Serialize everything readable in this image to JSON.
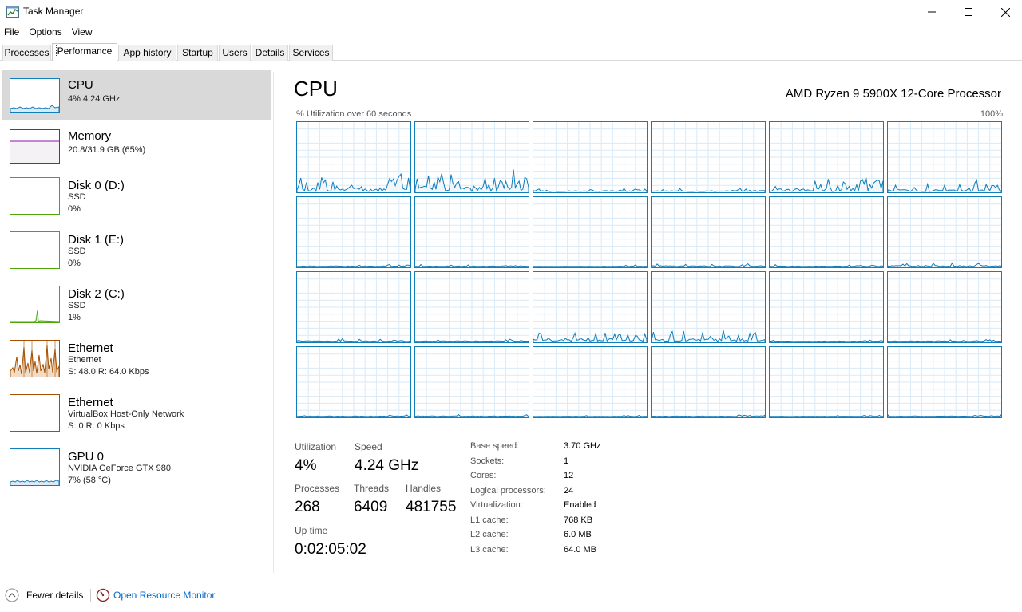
{
  "window": {
    "title": "Task Manager",
    "icon": "task-manager-icon",
    "controls": [
      "minimize-icon",
      "maximize-icon",
      "close-icon"
    ]
  },
  "menu": [
    "File",
    "Options",
    "View"
  ],
  "tabs": [
    "Processes",
    "Performance",
    "App history",
    "Startup",
    "Users",
    "Details",
    "Services"
  ],
  "active_tab": "Performance",
  "sidebar": [
    {
      "title": "CPU",
      "lines": [
        "4% 4.24 GHz"
      ],
      "color": "#117dbb"
    },
    {
      "title": "Memory",
      "lines": [
        "20.8/31.9 GB (65%)"
      ],
      "color": "#8b12ae"
    },
    {
      "title": "Disk 0 (D:)",
      "lines": [
        "SSD",
        "0%"
      ],
      "color": "#4da60c"
    },
    {
      "title": "Disk 1 (E:)",
      "lines": [
        "SSD",
        "0%"
      ],
      "color": "#4da60c"
    },
    {
      "title": "Disk 2 (C:)",
      "lines": [
        "SSD",
        "1%"
      ],
      "color": "#4da60c"
    },
    {
      "title": "Ethernet",
      "lines": [
        "Ethernet",
        "S: 48.0  R: 64.0 Kbps"
      ],
      "color": "#a74f01"
    },
    {
      "title": "Ethernet",
      "lines": [
        "VirtualBox Host-Only Network",
        "S: 0  R: 0 Kbps"
      ],
      "color": "#a74f01"
    },
    {
      "title": "GPU 0",
      "lines": [
        "NVIDIA GeForce GTX 980",
        "7% (58 °C)"
      ],
      "color": "#117dbb"
    }
  ],
  "main": {
    "title": "CPU",
    "model": "AMD Ryzen 9 5900X 12-Core Processor",
    "graph_label": "% Utilization over 60 seconds",
    "graph_max": "100%",
    "logical_processor_graphs": 24,
    "stats": {
      "utilization_label": "Utilization",
      "utilization": "4%",
      "speed_label": "Speed",
      "speed": "4.24 GHz",
      "processes_label": "Processes",
      "processes": "268",
      "threads_label": "Threads",
      "threads": "6409",
      "handles_label": "Handles",
      "handles": "481755",
      "uptime_label": "Up time",
      "uptime": "0:02:05:02"
    },
    "specs": [
      {
        "label": "Base speed:",
        "value": "3.70 GHz"
      },
      {
        "label": "Sockets:",
        "value": "1"
      },
      {
        "label": "Cores:",
        "value": "12"
      },
      {
        "label": "Logical processors:",
        "value": "24"
      },
      {
        "label": "Virtualization:",
        "value": "Enabled"
      },
      {
        "label": "L1 cache:",
        "value": "768 KB"
      },
      {
        "label": "L2 cache:",
        "value": "6.0 MB"
      },
      {
        "label": "L3 cache:",
        "value": "64.0 MB"
      }
    ]
  },
  "footer": {
    "fewer_details": "Fewer details",
    "fewer_icon": "chevron-up-circle-icon",
    "monitor_link": "Open Resource Monitor",
    "monitor_icon": "resource-monitor-icon"
  },
  "colors": {
    "cpu": "#117dbb",
    "memory": "#8b12ae",
    "disk": "#4da60c",
    "ethernet": "#a74f01",
    "link": "#0066cc",
    "selected": "#d9d9d9"
  }
}
